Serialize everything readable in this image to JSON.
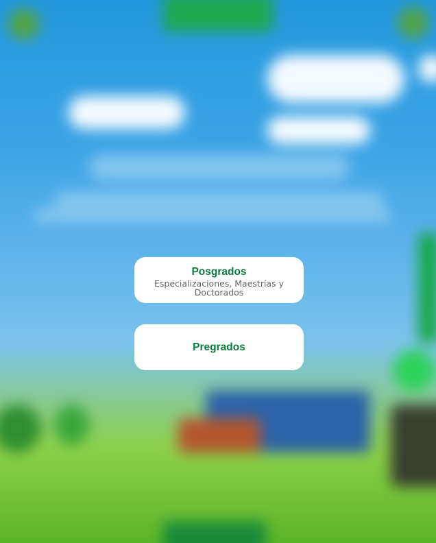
{
  "colors": {
    "card_title": "#0b7d3c",
    "card_subtitle": "#666666",
    "card_background": "#ffffff"
  },
  "options": [
    {
      "title": "Posgrados",
      "subtitle": "Especializaciones, Maestrías y Doctorados"
    },
    {
      "title": "Pregrados"
    }
  ]
}
